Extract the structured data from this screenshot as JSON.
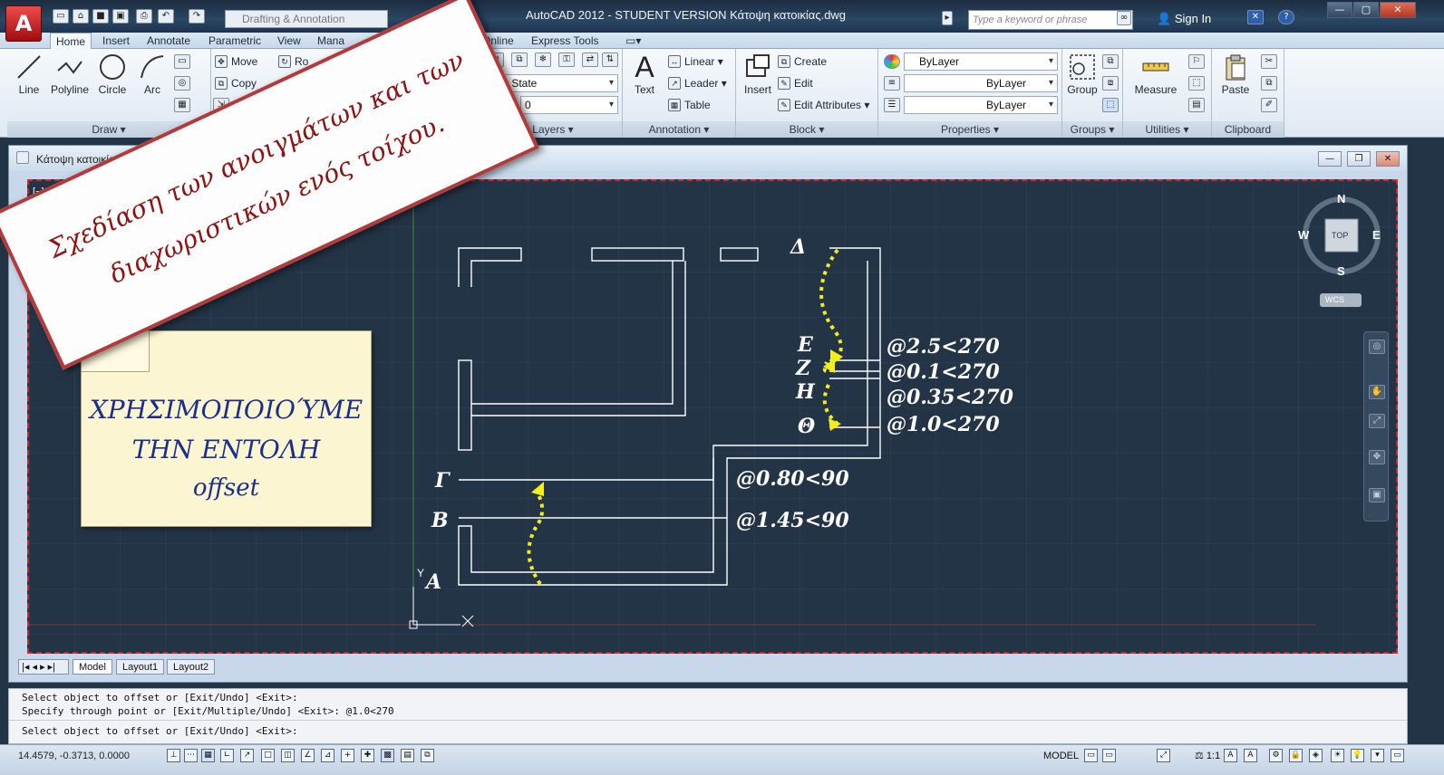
{
  "app": {
    "title": "AutoCAD 2012 - STUDENT VERSION     Κάτοψη κατοικίας.dwg",
    "menu_button": "A",
    "workspace": "Drafting & Annotation",
    "search_placeholder": "Type a keyword or phrase",
    "sign_in": "Sign In"
  },
  "ribbon_tabs": [
    "Home",
    "Insert",
    "Annotate",
    "Parametric",
    "View",
    "Mana",
    "Online",
    "Express Tools"
  ],
  "ribbon": {
    "draw": {
      "title": "Draw",
      "tools": [
        "Line",
        "Polyline",
        "Circle",
        "Arc"
      ]
    },
    "modify": {
      "move": "Move",
      "copy": "Copy",
      "rotate": "Ro"
    },
    "layers": {
      "title": "Layers",
      "layer_state": "r State",
      "current_layer": "0"
    },
    "annotation": {
      "title": "Annotation",
      "text": "Text",
      "linear": "Linear",
      "leader": "Leader",
      "table": "Table"
    },
    "block": {
      "title": "Block",
      "insert": "Insert",
      "create": "Create",
      "edit": "Edit",
      "edit_attributes": "Edit Attributes"
    },
    "properties": {
      "title": "Properties",
      "color": "ByLayer",
      "linetype": "ByLayer",
      "lineweight": "ByLayer"
    },
    "groups": {
      "title": "Groups",
      "group": "Group"
    },
    "utilities": {
      "title": "Utilities",
      "measure": "Measure"
    },
    "clipboard": {
      "title": "Clipboard",
      "paste": "Paste"
    }
  },
  "drawing_window": {
    "title": "Κάτοψη κατοικίας.dw",
    "viewport_label": "[−] [Top] [",
    "compass": {
      "n": "N",
      "s": "S",
      "e": "E",
      "w": "W",
      "cube": "TOP",
      "wcs": "WCS"
    },
    "ucs": {
      "y": "Y"
    }
  },
  "annotations": {
    "points_left": [
      "Γ",
      "Β",
      "Α"
    ],
    "points_right": [
      "Δ",
      "Ε",
      "Ζ",
      "Η",
      "Θ"
    ],
    "offsets_right": [
      "@2.5<270",
      "@0.1<270",
      "@0.35<270",
      "@1.0<270"
    ],
    "offsets_left": [
      "@0.80<90",
      "@1.45<90"
    ]
  },
  "banner": {
    "line1": "Σχεδίαση των ανοιγμάτων και των",
    "line2": "διαχωριστικών ενός τοίχου."
  },
  "sticky": {
    "line1": "ΧΡΗΣΙΜΟΠΟΙΟΎΜΕ",
    "line2": "ΤΗΝ ΕΝΤΟΛΗ",
    "line3": "offset"
  },
  "layout_tabs": [
    "Model",
    "Layout1",
    "Layout2"
  ],
  "command_line": [
    "Select object to offset or [Exit/Undo] <Exit>:",
    "Specify through point or [Exit/Multiple/Undo] <Exit>: @1.0<270",
    "Select object to offset or [Exit/Undo] <Exit>:"
  ],
  "status": {
    "coords": "14.4579, -0.3713, 0.0000",
    "model": "MODEL",
    "scale": "1:1"
  },
  "colors": {
    "viewport_bg": "#243447",
    "arrow": "#f2ee1a",
    "banner_border": "#b33a3a",
    "banner_text": "#8c1414",
    "sticky_text": "#1a2e8a"
  }
}
